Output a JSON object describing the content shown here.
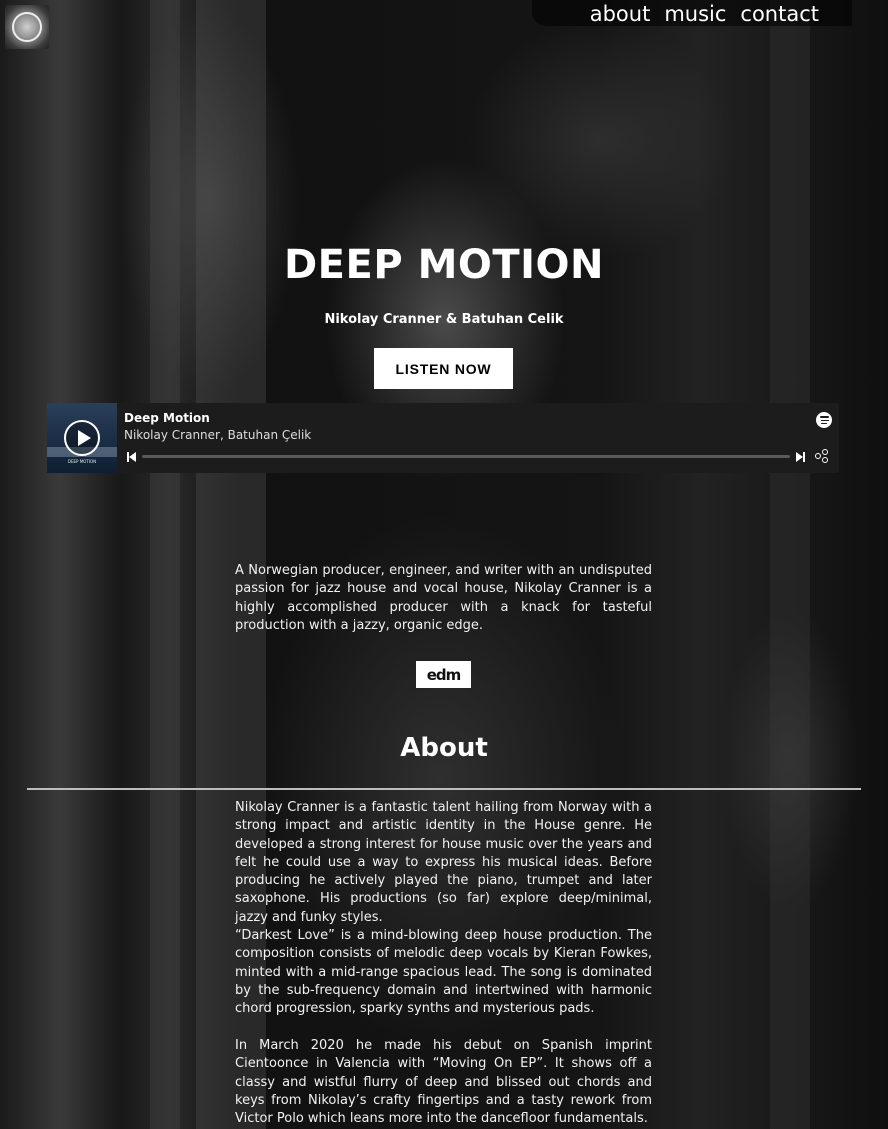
{
  "header": {
    "nav": [
      "about",
      "music",
      "contact"
    ]
  },
  "hero": {
    "title": "DEEP MOTION",
    "artists": "Nikolay Cranner & Batuhan Celik",
    "cta_label": "LISTEN NOW"
  },
  "player": {
    "track_title": "Deep Motion",
    "track_artists": "Nikolay Cranner, Batuhan Çelik",
    "cover_text": "DEEP MOTION",
    "icons": [
      "play-icon",
      "spotify-icon",
      "previous-icon",
      "next-icon",
      "share-icon"
    ]
  },
  "intro": "A Norwegian producer, engineer, and writer with an undisputed passion for jazz house and vocal house, Nikolay Cranner is a highly accomplished producer with a knack for tasteful production with a jazzy, organic edge.",
  "press_logo": "edm",
  "about": {
    "heading": "About",
    "paragraphs": [
      "Nikolay Cranner is a fantastic talent hailing from Norway with a strong impact and artistic identity in the House genre. He developed a strong interest for house music over the years and felt he could use a way to express his musical ideas. Before producing he actively played the piano, trumpet and later saxophone. His productions (so far) explore deep/minimal, jazzy and funky styles.",
      "“Darkest Love” is a mind-blowing deep house production. The composition consists of melodic deep vocals by Kieran Fowkes, minted with a mid-range spacious lead. The song is dominated by the sub-frequency domain and intertwined with harmonic chord progression, sparky synths and mysterious pads.",
      "In March 2020 he made his debut on Spanish imprint Cientoonce in Valencia with “Moving On EP”. It shows off a classy and wistful flurry of deep and blissed out chords and keys from Nikolay’s crafty fingertips and a tasty rework from Victor Polo which leans more into the dancefloor fundamentals."
    ]
  }
}
